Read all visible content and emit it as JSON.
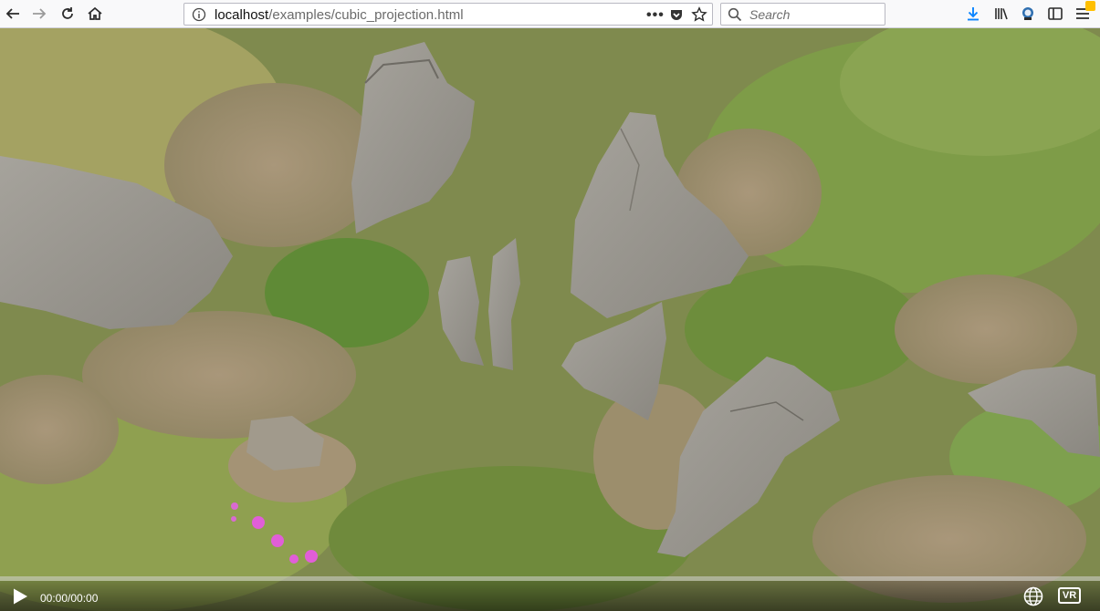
{
  "browser": {
    "url_host": "localhost",
    "url_path": "/examples/cubic_projection.html",
    "search_placeholder": "Search",
    "icons": [
      "back-icon",
      "forward-icon",
      "reload-icon",
      "home-icon",
      "info-icon",
      "more-icon",
      "pocket-icon",
      "bookmark-star-icon",
      "search-icon",
      "download-icon",
      "library-icon",
      "extension-icon",
      "sidebar-icon",
      "menu-icon"
    ],
    "accent_color": "#0a84ff",
    "notification_color": "#ffbf00"
  },
  "player": {
    "time_display": "00:00/00:00",
    "vr_label": "VR",
    "progress": 0,
    "icons": [
      "play-icon",
      "projection-globe-icon"
    ]
  }
}
